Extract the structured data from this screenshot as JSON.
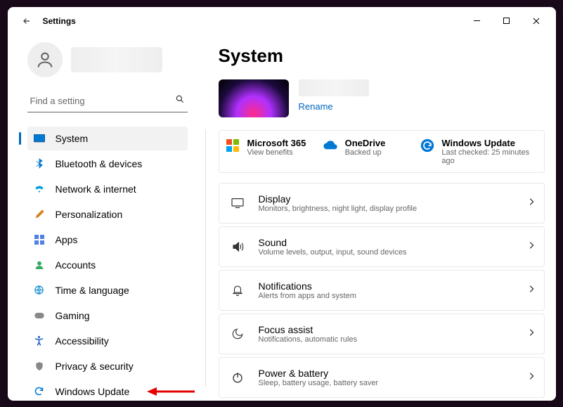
{
  "window_title": "Settings",
  "search_placeholder": "Find a setting",
  "page_title": "System",
  "rename_label": "Rename",
  "nav": [
    {
      "label": "System",
      "icon": "system"
    },
    {
      "label": "Bluetooth & devices",
      "icon": "bluetooth"
    },
    {
      "label": "Network & internet",
      "icon": "wifi"
    },
    {
      "label": "Personalization",
      "icon": "brush"
    },
    {
      "label": "Apps",
      "icon": "apps"
    },
    {
      "label": "Accounts",
      "icon": "account"
    },
    {
      "label": "Time & language",
      "icon": "globe"
    },
    {
      "label": "Gaming",
      "icon": "gaming"
    },
    {
      "label": "Accessibility",
      "icon": "accessibility"
    },
    {
      "label": "Privacy & security",
      "icon": "shield"
    },
    {
      "label": "Windows Update",
      "icon": "update"
    }
  ],
  "status": {
    "ms365": {
      "title": "Microsoft 365",
      "sub": "View benefits"
    },
    "onedrive": {
      "title": "OneDrive",
      "sub": "Backed up"
    },
    "update": {
      "title": "Windows Update",
      "sub": "Last checked: 25 minutes ago"
    }
  },
  "settings": [
    {
      "title": "Display",
      "sub": "Monitors, brightness, night light, display profile",
      "icon": "display"
    },
    {
      "title": "Sound",
      "sub": "Volume levels, output, input, sound devices",
      "icon": "sound"
    },
    {
      "title": "Notifications",
      "sub": "Alerts from apps and system",
      "icon": "bell"
    },
    {
      "title": "Focus assist",
      "sub": "Notifications, automatic rules",
      "icon": "moon"
    },
    {
      "title": "Power & battery",
      "sub": "Sleep, battery usage, battery saver",
      "icon": "power"
    }
  ]
}
